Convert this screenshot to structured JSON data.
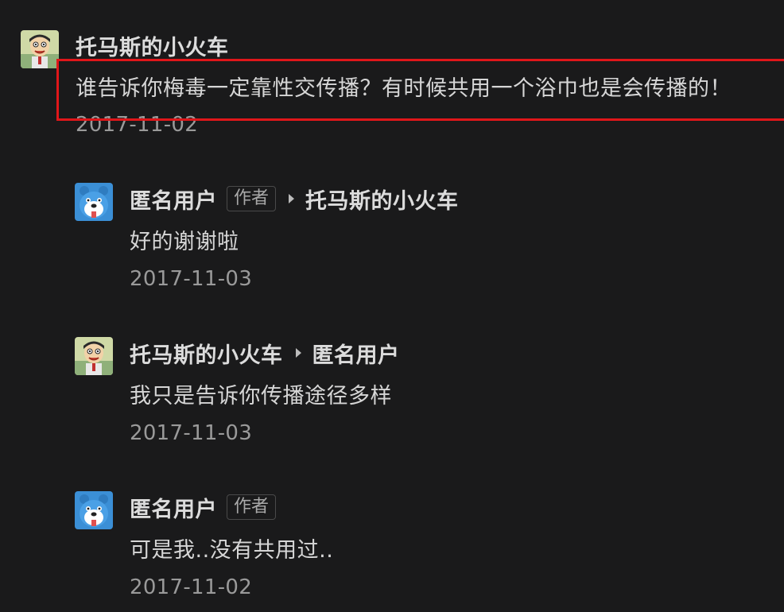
{
  "comments": [
    {
      "author": "托马斯的小火车",
      "avatar_icon": "cartoon-boy-avatar-icon",
      "text": "谁告诉你梅毒一定靠性交传播？有时候共用一个浴巾也是会传播的！",
      "date": "2017-11-02"
    },
    {
      "author": "匿名用户",
      "avatar_icon": "blue-bear-avatar-icon",
      "badge": "作者",
      "reply_to": "托马斯的小火车",
      "text": "好的谢谢啦",
      "date": "2017-11-03"
    },
    {
      "author": "托马斯的小火车",
      "avatar_icon": "cartoon-boy-avatar-icon",
      "reply_to": "匿名用户",
      "text": "我只是告诉你传播途径多样",
      "date": "2017-11-03"
    },
    {
      "author": "匿名用户",
      "avatar_icon": "blue-bear-avatar-icon",
      "badge": "作者",
      "text": "可是我..没有共用过..",
      "date": "2017-11-02"
    }
  ],
  "colors": {
    "background": "#1a1a1b",
    "highlight_border": "#e0161a",
    "avatar_blue": "#3b8fd6"
  }
}
